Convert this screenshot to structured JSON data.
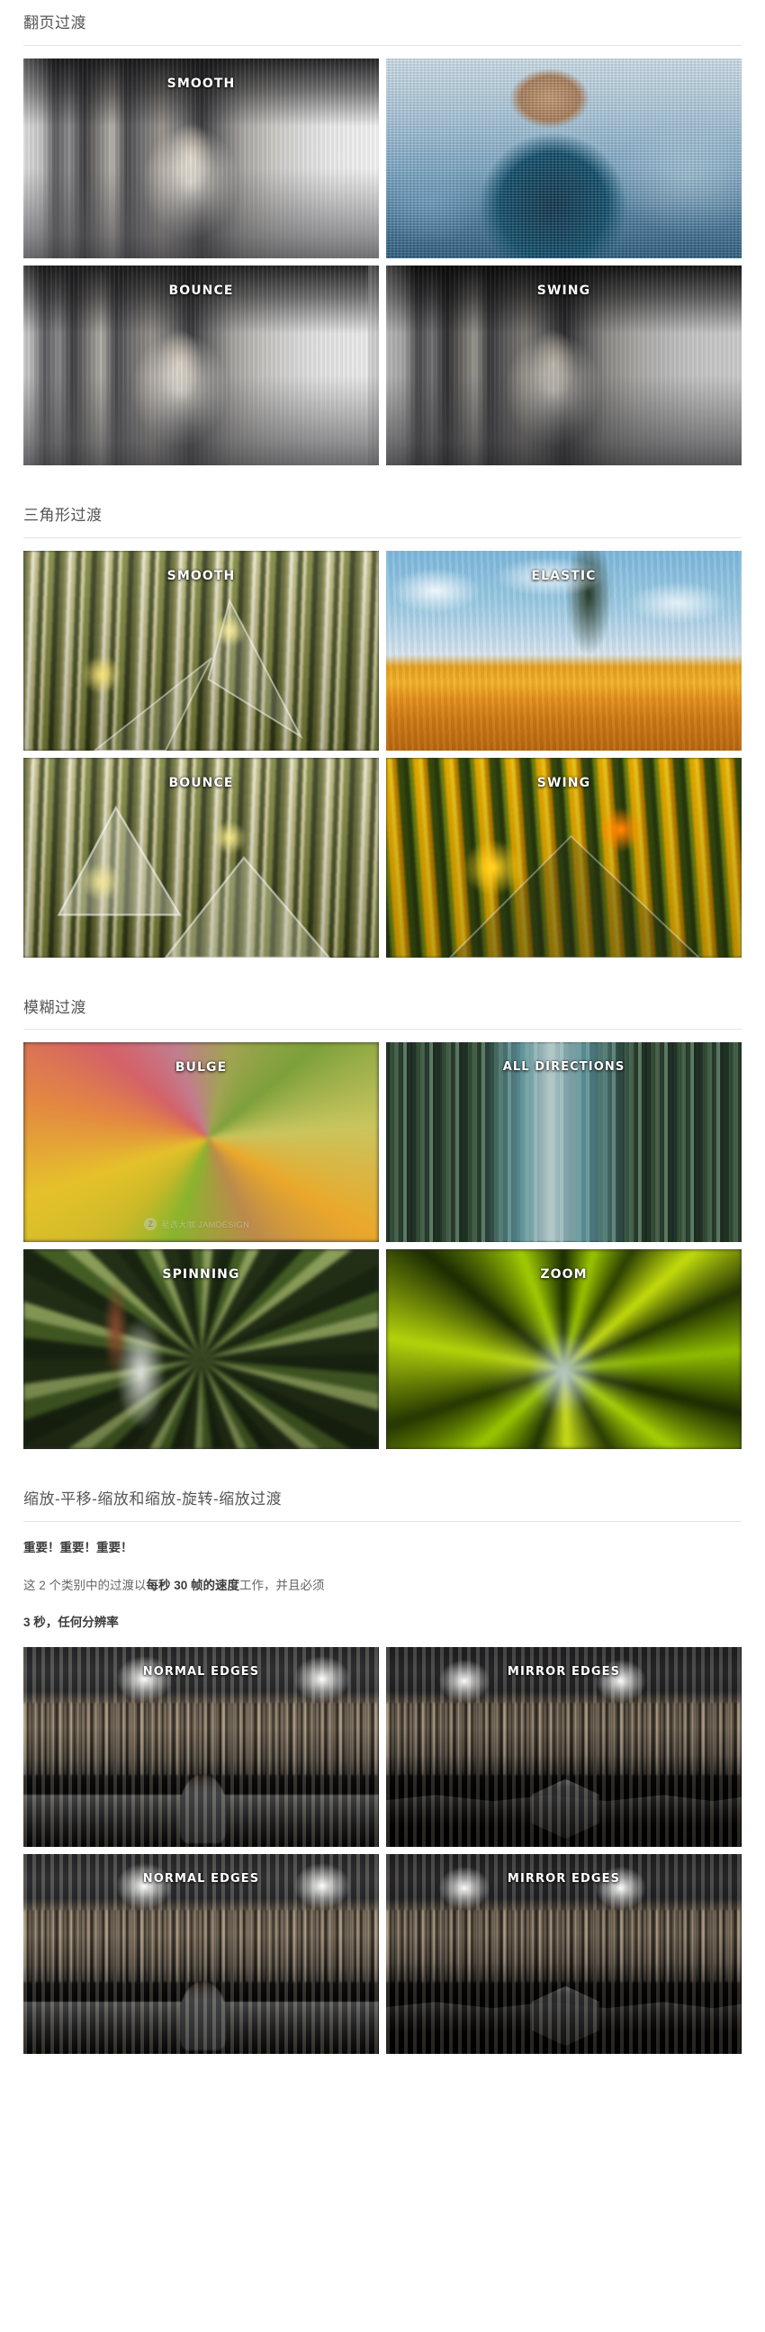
{
  "sections": [
    {
      "id": "page-flip",
      "title": "翻页过渡",
      "rows": [
        {
          "tiles": [
            {
              "label": "SMOOTH",
              "art": "corridor"
            },
            {
              "label": "",
              "art": "suit"
            }
          ]
        },
        {
          "tiles": [
            {
              "label": "BOUNCE",
              "art": "corridor-v2"
            },
            {
              "label": "SWING",
              "art": "corridor-dark"
            }
          ]
        }
      ]
    },
    {
      "id": "triangle",
      "title": "三角形过渡",
      "rows": [
        {
          "tiles": [
            {
              "label": "SMOOTH",
              "art": "daisy"
            },
            {
              "label": "ELASTIC",
              "art": "sky"
            }
          ]
        },
        {
          "tiles": [
            {
              "label": "BOUNCE",
              "art": "daisy-2"
            },
            {
              "label": "SWING",
              "art": "marigold"
            }
          ]
        }
      ]
    },
    {
      "id": "blur",
      "title": "模糊过渡",
      "rows": [
        {
          "tiles": [
            {
              "label": "BULGE",
              "art": "bulge",
              "watermark": true
            },
            {
              "label": "ALL DIRECTIONS",
              "art": "streak"
            }
          ]
        },
        {
          "tiles": [
            {
              "label": "SPINNING",
              "art": "spin"
            },
            {
              "label": "ZOOM",
              "art": "zoom"
            }
          ]
        }
      ]
    },
    {
      "id": "zoom-pan",
      "title": "缩放-平移-缩放和缩放-旋转-缩放过渡",
      "notice": {
        "heading": "重要！重要！重要！",
        "line1_prefix": "这 2 个类别中的过渡以",
        "line1_bold": "每秒 30 帧的速度",
        "line1_suffix": "工作，并且必须",
        "line2": "3 秒，任何分辨率"
      },
      "rows": [
        {
          "tiles": [
            {
              "label": "NORMAL EDGES",
              "art": "hall"
            },
            {
              "label": "MIRROR EDGES",
              "art": "hall-mirror"
            }
          ]
        },
        {
          "tiles": [
            {
              "label": "NORMAL EDGES",
              "art": "hall-2"
            },
            {
              "label": "MIRROR EDGES",
              "art": "hall-mirror-2"
            }
          ]
        }
      ]
    }
  ],
  "watermark": {
    "mark": "Z",
    "text": "星选大咖 JAMDESIGN"
  }
}
